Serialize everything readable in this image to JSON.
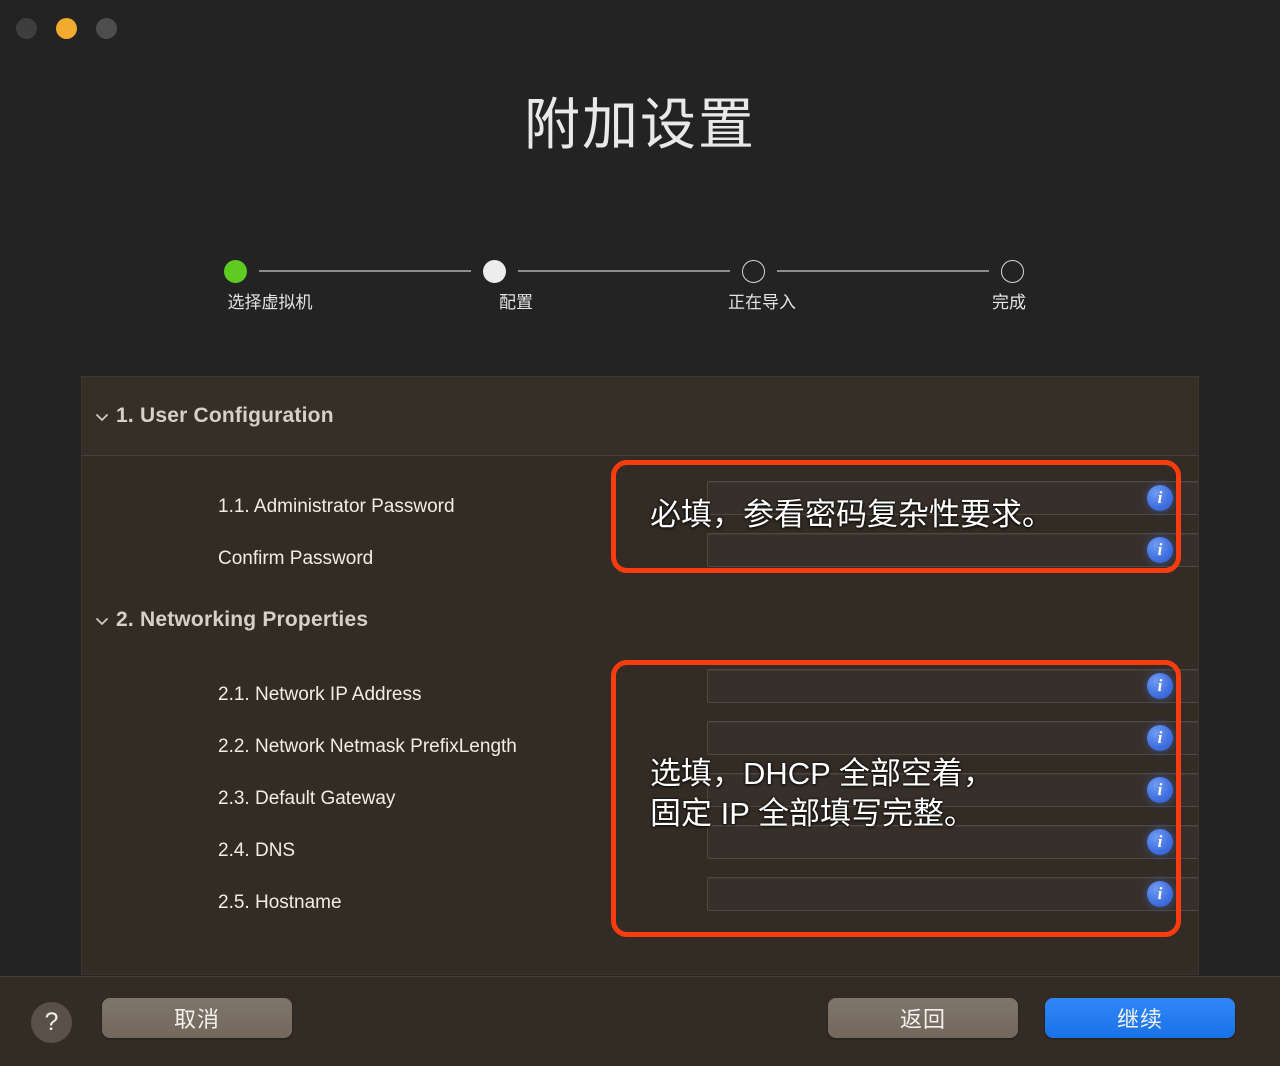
{
  "window": {
    "title": "附加设置",
    "traffic_lights": [
      {
        "name": "close",
        "color": "#3e3e3e"
      },
      {
        "name": "minimize",
        "color": "#f2ab2e"
      },
      {
        "name": "zoom",
        "color": "#4d4d4d"
      }
    ]
  },
  "stepper": {
    "steps": [
      {
        "label": "选择虚拟机",
        "state": "done"
      },
      {
        "label": "配置",
        "state": "current"
      },
      {
        "label": "正在导入",
        "state": "todo"
      },
      {
        "label": "完成",
        "state": "todo"
      }
    ]
  },
  "sections": [
    {
      "title": "1. User Configuration",
      "fields": [
        {
          "label": "1.1. Administrator Password",
          "value": "",
          "info": "i"
        },
        {
          "label": "Confirm Password",
          "value": "",
          "info": "i"
        }
      ]
    },
    {
      "title": "2. Networking Properties",
      "fields": [
        {
          "label": "2.1. Network IP Address",
          "value": "",
          "info": "i"
        },
        {
          "label": "2.2. Network Netmask PrefixLength",
          "value": "",
          "info": "i"
        },
        {
          "label": "2.3. Default Gateway",
          "value": "",
          "info": "i"
        },
        {
          "label": "2.4. DNS",
          "value": "",
          "info": "i"
        },
        {
          "label": "2.5. Hostname",
          "value": "",
          "info": "i"
        }
      ]
    }
  ],
  "annotations": [
    {
      "text": "必填，参看密码复杂性要求。",
      "color": "#f93b10"
    },
    {
      "text": "选填，DHCP 全部空着，\n固定 IP 全部填写完整。",
      "color": "#f93b10"
    }
  ],
  "footer": {
    "help_label": "?",
    "cancel_label": "取消",
    "back_label": "返回",
    "continue_label": "继续",
    "continue_color": "#1a72e8"
  }
}
